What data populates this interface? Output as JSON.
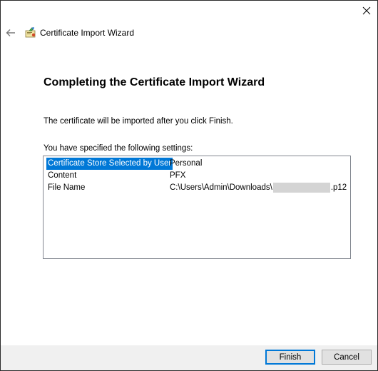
{
  "header": {
    "title": "Certificate Import Wizard"
  },
  "main": {
    "heading": "Completing the Certificate Import Wizard",
    "info_text": "The certificate will be imported after you click Finish.",
    "settings_label": "You have specified the following settings:",
    "settings": [
      {
        "key": "Certificate Store Selected by User",
        "value": "Personal"
      },
      {
        "key": "Content",
        "value": "PFX"
      },
      {
        "key": "File Name",
        "value_prefix": "C:\\Users\\Admin\\Downloads\\",
        "value_suffix": ".p12"
      }
    ]
  },
  "footer": {
    "finish_label": "Finish",
    "cancel_label": "Cancel"
  },
  "colors": {
    "selection": "#0078d7",
    "footer_bg": "#f0f0f0"
  },
  "icons": {
    "close": "close-icon",
    "back": "back-arrow-icon",
    "wizard": "certificate-wizard-icon"
  }
}
